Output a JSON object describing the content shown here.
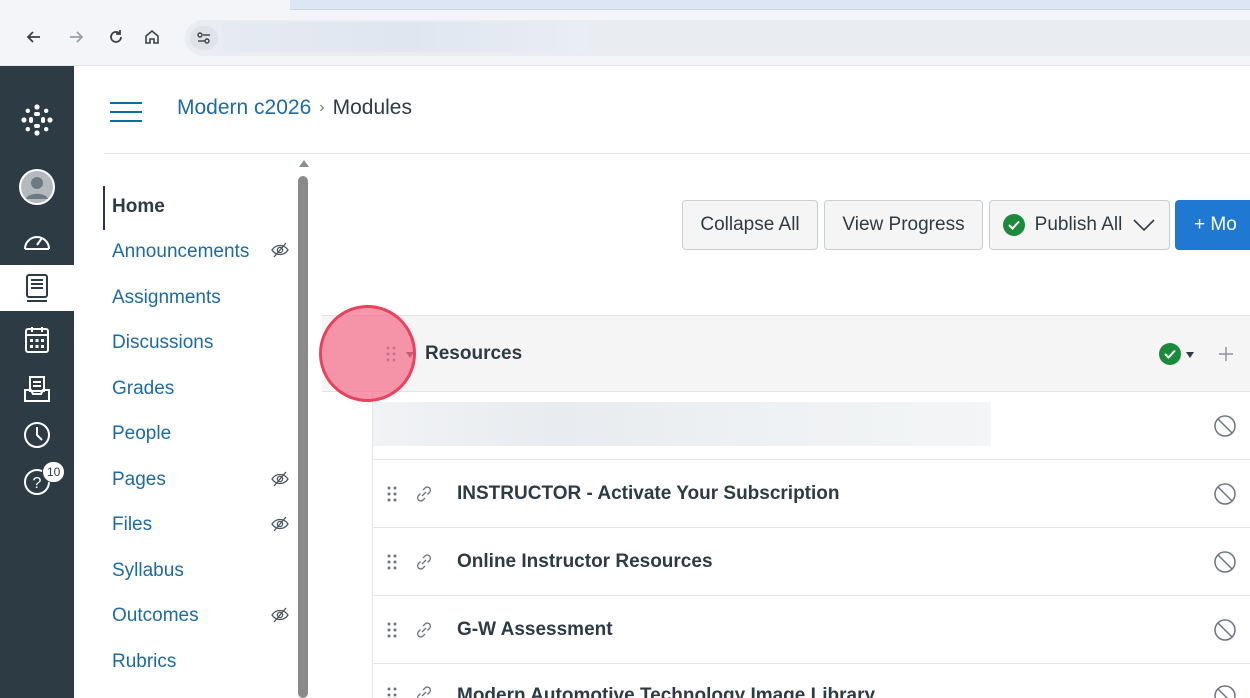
{
  "browser": {
    "back_icon": "arrow-left-icon",
    "forward_icon": "arrow-right-icon",
    "reload_icon": "reload-icon",
    "home_icon": "home-icon",
    "site_info_icon": "tune-icon"
  },
  "global_nav": {
    "items": [
      {
        "icon": "logo-icon"
      },
      {
        "icon": "account-icon"
      },
      {
        "icon": "dashboard-icon"
      },
      {
        "icon": "courses-icon",
        "active": true
      },
      {
        "icon": "calendar-icon"
      },
      {
        "icon": "inbox-icon"
      },
      {
        "icon": "history-icon"
      },
      {
        "icon": "help-icon",
        "badge": "10"
      }
    ]
  },
  "header": {
    "course_name": "Modern c2026",
    "separator": "›",
    "page": "Modules"
  },
  "course_nav": {
    "items": [
      {
        "label": "Home",
        "active": true,
        "hidden": false
      },
      {
        "label": "Announcements",
        "hidden": true
      },
      {
        "label": "Assignments",
        "hidden": false
      },
      {
        "label": "Discussions",
        "hidden": false
      },
      {
        "label": "Grades",
        "hidden": false
      },
      {
        "label": "People",
        "hidden": false
      },
      {
        "label": "Pages",
        "hidden": true
      },
      {
        "label": "Files",
        "hidden": true
      },
      {
        "label": "Syllabus",
        "hidden": false
      },
      {
        "label": "Outcomes",
        "hidden": true
      },
      {
        "label": "Rubrics",
        "hidden": false
      }
    ]
  },
  "toolbar": {
    "collapse_all": "Collapse All",
    "view_progress": "View Progress",
    "publish_all": "Publish All",
    "add_module": "+ Mo"
  },
  "module": {
    "title": "Resources",
    "items": [
      {
        "title": "",
        "blurred": true
      },
      {
        "title": "INSTRUCTOR - Activate Your Subscription",
        "icon": "link-icon"
      },
      {
        "title": "Online Instructor Resources",
        "icon": "link-icon"
      },
      {
        "title": "G-W Assessment",
        "icon": "link-icon"
      },
      {
        "title": "Modern Automotive Technology Image Library",
        "icon": "link-icon"
      }
    ]
  },
  "colors": {
    "nav_bg": "#2d3b45",
    "link": "#1d6aa5",
    "primary": "#1f78d1",
    "success": "#1b8a3a"
  }
}
